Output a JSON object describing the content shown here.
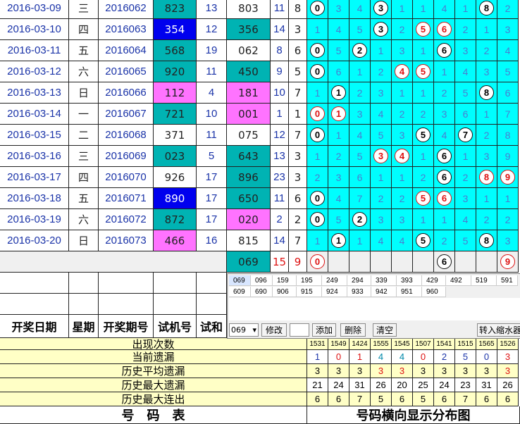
{
  "rows": [
    {
      "date": "2016-03-09",
      "weekday": "三",
      "period": "2016062",
      "test": "823",
      "test_style": "teal",
      "n1": "13",
      "draw": "803",
      "draw_style": "",
      "sum": "11",
      "span": "8",
      "dist": [
        "0",
        "3",
        "4",
        "3",
        "1",
        "1",
        "4",
        "1",
        "8",
        "2"
      ],
      "hits": [
        0,
        3,
        8
      ]
    },
    {
      "date": "2016-03-10",
      "weekday": "四",
      "period": "2016063",
      "test": "354",
      "test_style": "navy",
      "n1": "12",
      "draw": "356",
      "draw_style": "teal",
      "sum": "14",
      "span": "3",
      "dist": [
        "1",
        "4",
        "5",
        "3",
        "2",
        "5",
        "6",
        "2",
        "1",
        "3"
      ],
      "hits": [
        3,
        5,
        6
      ]
    },
    {
      "date": "2016-03-11",
      "weekday": "五",
      "period": "2016064",
      "test": "568",
      "test_style": "teal",
      "n1": "19",
      "draw": "062",
      "draw_style": "",
      "sum": "8",
      "span": "6",
      "dist": [
        "0",
        "5",
        "2",
        "1",
        "3",
        "1",
        "6",
        "3",
        "2",
        "4"
      ],
      "hits": [
        0,
        2,
        6
      ]
    },
    {
      "date": "2016-03-12",
      "weekday": "六",
      "period": "2016065",
      "test": "920",
      "test_style": "teal",
      "n1": "11",
      "draw": "450",
      "draw_style": "teal",
      "sum": "9",
      "span": "5",
      "dist": [
        "0",
        "6",
        "1",
        "2",
        "4",
        "5",
        "1",
        "4",
        "3",
        "5"
      ],
      "hits": [
        0,
        4,
        5
      ]
    },
    {
      "date": "2016-03-13",
      "weekday": "日",
      "period": "2016066",
      "test": "112",
      "test_style": "pink",
      "n1": "4",
      "draw": "181",
      "draw_style": "pink",
      "sum": "10",
      "span": "7",
      "dist": [
        "1",
        "1",
        "2",
        "3",
        "1",
        "1",
        "2",
        "5",
        "8",
        "6"
      ],
      "hits": [
        1,
        8
      ]
    },
    {
      "date": "2016-03-14",
      "weekday": "一",
      "period": "2016067",
      "test": "721",
      "test_style": "teal",
      "n1": "10",
      "draw": "001",
      "draw_style": "pink",
      "sum": "1",
      "span": "1",
      "dist": [
        "0",
        "1",
        "3",
        "4",
        "2",
        "2",
        "3",
        "6",
        "1",
        "7"
      ],
      "hits": [
        0,
        1
      ]
    },
    {
      "date": "2016-03-15",
      "weekday": "二",
      "period": "2016068",
      "test": "371",
      "test_style": "",
      "n1": "11",
      "draw": "075",
      "draw_style": "",
      "sum": "12",
      "span": "7",
      "dist": [
        "0",
        "1",
        "4",
        "5",
        "3",
        "5",
        "4",
        "7",
        "2",
        "8"
      ],
      "hits": [
        0,
        5,
        7
      ]
    },
    {
      "date": "2016-03-16",
      "weekday": "三",
      "period": "2016069",
      "test": "023",
      "test_style": "teal",
      "n1": "5",
      "draw": "643",
      "draw_style": "teal",
      "sum": "13",
      "span": "3",
      "dist": [
        "1",
        "2",
        "5",
        "3",
        "4",
        "1",
        "6",
        "1",
        "3",
        "9"
      ],
      "hits": [
        3,
        4,
        6
      ]
    },
    {
      "date": "2016-03-17",
      "weekday": "四",
      "period": "2016070",
      "test": "926",
      "test_style": "",
      "n1": "17",
      "draw": "896",
      "draw_style": "teal",
      "sum": "23",
      "span": "3",
      "dist": [
        "2",
        "3",
        "6",
        "1",
        "1",
        "2",
        "6",
        "2",
        "8",
        "9"
      ],
      "hits": [
        6,
        8,
        9
      ]
    },
    {
      "date": "2016-03-18",
      "weekday": "五",
      "period": "2016071",
      "test": "890",
      "test_style": "navy",
      "n1": "17",
      "draw": "650",
      "draw_style": "teal",
      "sum": "11",
      "span": "6",
      "dist": [
        "0",
        "4",
        "7",
        "2",
        "2",
        "5",
        "6",
        "3",
        "1",
        "1"
      ],
      "hits": [
        0,
        5,
        6
      ]
    },
    {
      "date": "2016-03-19",
      "weekday": "六",
      "period": "2016072",
      "test": "872",
      "test_style": "teal",
      "n1": "17",
      "draw": "020",
      "draw_style": "pink",
      "sum": "2",
      "span": "2",
      "dist": [
        "0",
        "5",
        "2",
        "3",
        "3",
        "1",
        "1",
        "4",
        "2",
        "2"
      ],
      "hits": [
        0,
        2
      ]
    },
    {
      "date": "2016-03-20",
      "weekday": "日",
      "period": "2016073",
      "test": "466",
      "test_style": "pink",
      "n1": "16",
      "draw": "815",
      "draw_style": "",
      "sum": "14",
      "span": "7",
      "dist": [
        "1",
        "1",
        "1",
        "4",
        "4",
        "5",
        "2",
        "5",
        "8",
        "3"
      ],
      "hits": [
        1,
        5,
        8
      ]
    }
  ],
  "predict": {
    "draw": "069",
    "sum": "15",
    "span": "9",
    "balls": [
      "0",
      "6",
      "9"
    ]
  },
  "panel": {
    "numbers": [
      "069",
      "096",
      "159",
      "195",
      "249",
      "294",
      "339",
      "393",
      "429",
      "492",
      "519",
      "591",
      "609",
      "690",
      "906",
      "915",
      "924",
      "933",
      "942",
      "951",
      "960"
    ],
    "select_value": "069",
    "buttons": {
      "modify": "修改",
      "add": "添加",
      "delete": "删除",
      "clear": "清空",
      "shrink": "转入缩水器"
    }
  },
  "headers": {
    "date": "开奖日期",
    "weekday": "星期",
    "period": "开奖期号",
    "test": "试机号",
    "test2": "试和"
  },
  "stats": {
    "labels": [
      "出现次数",
      "当前遗漏",
      "历史平均遗漏",
      "历史最大遗漏",
      "历史最大连出"
    ],
    "counts": [
      "1531",
      "1549",
      "1424",
      "1555",
      "1545",
      "1507",
      "1541",
      "1515",
      "1565",
      "1526"
    ],
    "current": [
      "1",
      "0",
      "1",
      "4",
      "4",
      "0",
      "2",
      "5",
      "0",
      "3"
    ],
    "current_colors": [
      "#1a33a8",
      "#d11",
      "#d11",
      "#08a",
      "#08a",
      "#d11",
      "#1a33a8",
      "#1a33a8",
      "#1a33a8",
      "#d11"
    ],
    "avg": [
      "3",
      "3",
      "3",
      "3",
      "3",
      "3",
      "3",
      "3",
      "3",
      "3"
    ],
    "avg_colors": [
      "#000",
      "#000",
      "#000",
      "#d11",
      "#d11",
      "#000",
      "#000",
      "#000",
      "#000",
      "#d11"
    ],
    "max": [
      "21",
      "24",
      "31",
      "26",
      "20",
      "25",
      "24",
      "23",
      "31",
      "26"
    ],
    "max_run": [
      "6",
      "6",
      "7",
      "5",
      "6",
      "5",
      "6",
      "7",
      "6",
      "6"
    ]
  },
  "footer": {
    "left": "号　码　表",
    "right": "号码横向显示分布图"
  }
}
